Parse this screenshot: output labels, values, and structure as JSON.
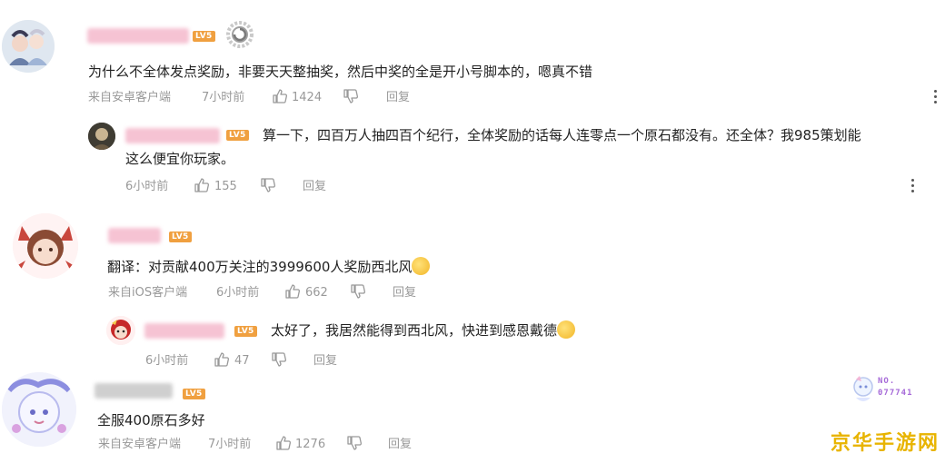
{
  "colors": {
    "meta_text": "#999999",
    "content_text": "#222222",
    "lv_badge": "#f0a040",
    "watermark": "#e8b400"
  },
  "comments": [
    {
      "level": "LV5",
      "content": "为什么不全体发点奖励，非要天天整抽奖，然后中奖的全是开小号脚本的，嗯真不错",
      "source": "来自安卓客户端",
      "time": "7小时前",
      "likes": "1424",
      "reply_label": "回复",
      "avatar_icon": "user-avatar-icon",
      "replies": [
        {
          "level": "LV5",
          "content_line1": "算一下，四百万人抽四百个纪行，全体奖励的话每人连零点一个原石都没有。还全体？我985策划能",
          "content_line2": "这么便宜你玩家。",
          "time": "6小时前",
          "likes": "155",
          "reply_label": "回复",
          "avatar_icon": "user-avatar-icon"
        }
      ]
    },
    {
      "level": "LV5",
      "content": "翻译：对贡献400万关注的3999600人奖励西北风",
      "emoji_icon": "laughing-emoji-icon",
      "source": "来自iOS客户端",
      "time": "6小时前",
      "likes": "662",
      "reply_label": "回复",
      "avatar_icon": "user-avatar-icon",
      "replies": [
        {
          "level": "LV5",
          "content": "太好了，我居然能得到西北风，快进到感恩戴德",
          "emoji_icon": "crying-laughing-emoji-icon",
          "time": "6小时前",
          "likes": "47",
          "reply_label": "回复",
          "avatar_icon": "user-avatar-icon"
        }
      ]
    },
    {
      "level": "LV5",
      "content": "全服400原石多好",
      "source": "来自安卓客户端",
      "time": "7小时前",
      "likes": "1276",
      "reply_label": "回复",
      "avatar_icon": "user-avatar-icon",
      "badge_text_line1": "NO.",
      "badge_text_line2": "077741"
    }
  ],
  "watermark": "京华手游网"
}
